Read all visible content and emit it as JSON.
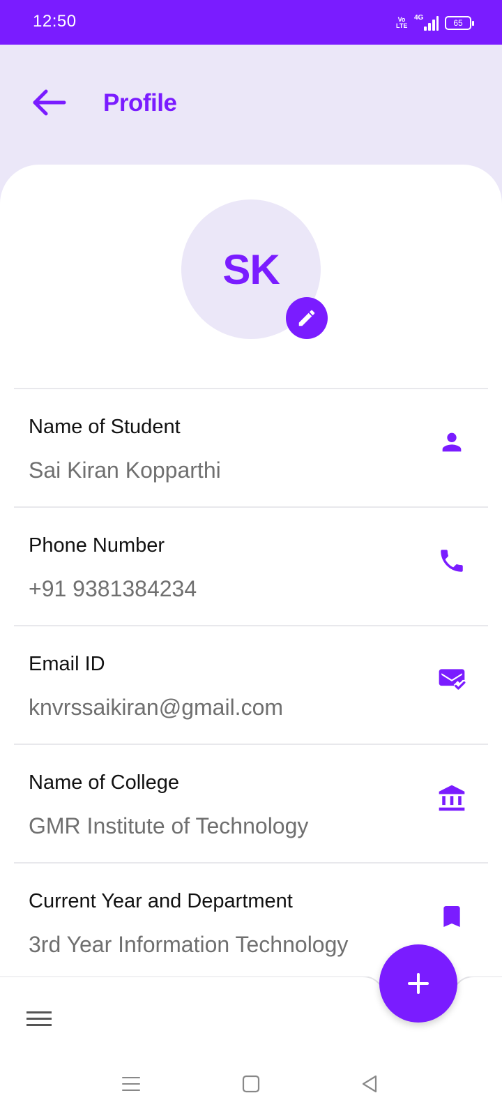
{
  "status_bar": {
    "time": "12:50",
    "volte_top": "Vo",
    "volte_bottom": "LTE",
    "network": "4G",
    "battery": "65"
  },
  "header": {
    "title": "Profile",
    "back_icon": "arrow-back-icon"
  },
  "profile": {
    "initials": "SK",
    "edit_icon": "pencil-icon"
  },
  "fields": [
    {
      "label": "Name of Student",
      "value": "Sai Kiran Kopparthi",
      "icon": "person-icon"
    },
    {
      "label": "Phone Number",
      "value": "+91 9381384234",
      "icon": "phone-icon"
    },
    {
      "label": "Email ID",
      "value": "knvrssaikiran@gmail.com",
      "icon": "mail-check-icon"
    },
    {
      "label": "Name of College",
      "value": "GMR Institute of Technology",
      "icon": "institution-icon"
    },
    {
      "label": "Current Year and Department",
      "value": "3rd Year Information Technology",
      "icon": "bookmark-icon"
    }
  ],
  "bottom_bar": {
    "menu_icon": "hamburger-menu-icon",
    "fab_icon": "plus-icon"
  },
  "nav_bar": {
    "recents_icon": "recents-icon",
    "home_icon": "home-square-icon",
    "back_icon": "back-triangle-icon"
  },
  "colors": {
    "accent": "#7a1cff",
    "header_background": "#ebe7f8",
    "card_background": "#ffffff",
    "label_text": "#111111",
    "value_text": "#6f6f6f"
  }
}
